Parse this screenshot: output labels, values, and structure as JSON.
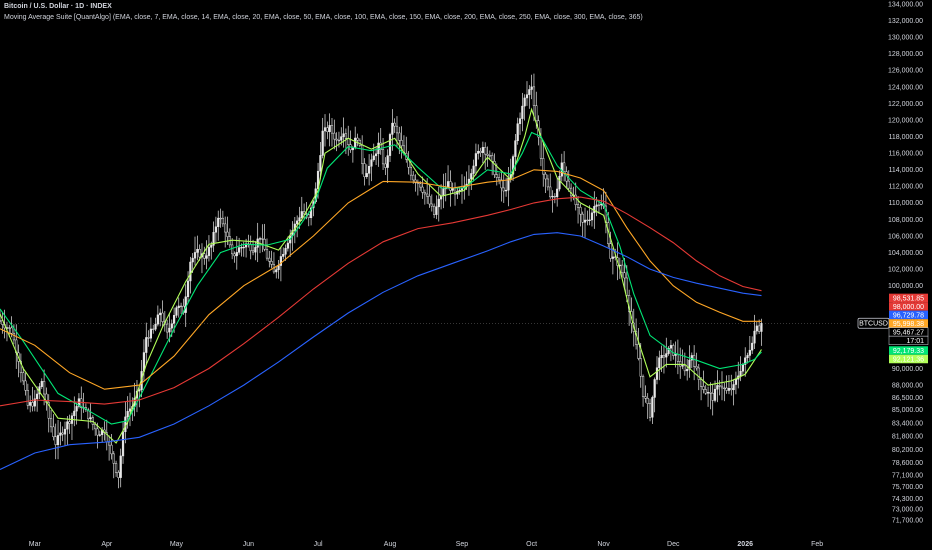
{
  "header": {
    "title": "Bitcoin / U.S. Dollar · 1D · INDEX",
    "indicator": "Moving Average Suite [QuantAlgo] (EMA, close, 7, EMA, close, 14, EMA, close, 20, EMA, close, 50, EMA, close, 100, EMA, close, 150, EMA, close, 200, EMA, close, 250, EMA, close, 300, EMA, close, 365)"
  },
  "colors": {
    "background": "#000000",
    "candle": "#e8e8e8",
    "axis_text": "#d1d4dc",
    "price_line": "#6b6b6b",
    "ema_light_green": "#b2ff59",
    "ema_green": "#00e676",
    "ema_orange": "#ffa726",
    "ema_red": "#e53935",
    "ema_blue": "#2962ff"
  },
  "chart_data": {
    "type": "candlestick",
    "symbol": "BTCUSD",
    "ylim": [
      70500,
      134500
    ],
    "y_ticks": [
      "134,000.00",
      "132,000.00",
      "130,000.00",
      "128,000.00",
      "126,000.00",
      "124,000.00",
      "122,000.00",
      "120,000.00",
      "118,000.00",
      "116,000.00",
      "114,000.00",
      "112,000.00",
      "110,000.00",
      "108,000.00",
      "106,000.00",
      "104,000.00",
      "102,000.00",
      "100,000.00",
      "98,000.00",
      "96,000.00",
      "94,000.00",
      "92,000.00",
      "90,000.00",
      "88,000.00",
      "86,500.00",
      "85,000.00",
      "83,400.00",
      "81,800.00",
      "80,200.00",
      "78,600.00",
      "77,100.00",
      "75,700.00",
      "74,300.00",
      "73,000.00",
      "71,700.00"
    ],
    "x_labels": [
      "Mar",
      "Apr",
      "May",
      "Jun",
      "Jul",
      "Aug",
      "Sep",
      "Oct",
      "Nov",
      "Dec",
      "2026",
      "Feb"
    ],
    "x_label_days": [
      0,
      31,
      61,
      92,
      122,
      153,
      184,
      214,
      245,
      275,
      306,
      337
    ],
    "x_range_days": [
      -15,
      352
    ],
    "close_anchors": [
      [
        -15,
        95800
      ],
      [
        -10,
        94500
      ],
      [
        -7,
        91200
      ],
      [
        -3,
        85500
      ],
      [
        0,
        86000
      ],
      [
        3,
        88500
      ],
      [
        6,
        84000
      ],
      [
        9,
        81000
      ],
      [
        12,
        82500
      ],
      [
        15,
        83800
      ],
      [
        19,
        86000
      ],
      [
        23,
        84300
      ],
      [
        27,
        82200
      ],
      [
        30,
        82600
      ],
      [
        33,
        79500
      ],
      [
        36,
        77000
      ],
      [
        39,
        84500
      ],
      [
        42,
        85500
      ],
      [
        45,
        87500
      ],
      [
        48,
        93800
      ],
      [
        51,
        94600
      ],
      [
        54,
        96800
      ],
      [
        57,
        94100
      ],
      [
        61,
        97500
      ],
      [
        64,
        97000
      ],
      [
        67,
        103000
      ],
      [
        70,
        104000
      ],
      [
        73,
        103500
      ],
      [
        76,
        104800
      ],
      [
        79,
        108500
      ],
      [
        82,
        106800
      ],
      [
        85,
        103500
      ],
      [
        88,
        104500
      ],
      [
        91,
        105000
      ],
      [
        94,
        104500
      ],
      [
        97,
        106000
      ],
      [
        100,
        103500
      ],
      [
        103,
        101500
      ],
      [
        106,
        103500
      ],
      [
        109,
        105500
      ],
      [
        112,
        107300
      ],
      [
        115,
        109000
      ],
      [
        118,
        108000
      ],
      [
        121,
        111500
      ],
      [
        124,
        118500
      ],
      [
        127,
        119000
      ],
      [
        130,
        117500
      ],
      [
        133,
        118800
      ],
      [
        136,
        116500
      ],
      [
        139,
        118000
      ],
      [
        142,
        113500
      ],
      [
        145,
        114800
      ],
      [
        148,
        117000
      ],
      [
        151,
        114000
      ],
      [
        154,
        119800
      ],
      [
        157,
        117500
      ],
      [
        160,
        115000
      ],
      [
        163,
        113000
      ],
      [
        166,
        112200
      ],
      [
        169,
        110500
      ],
      [
        172,
        108600
      ],
      [
        175,
        111000
      ],
      [
        178,
        112400
      ],
      [
        181,
        110800
      ],
      [
        184,
        111500
      ],
      [
        187,
        113200
      ],
      [
        190,
        115600
      ],
      [
        193,
        116800
      ],
      [
        196,
        115400
      ],
      [
        199,
        113000
      ],
      [
        202,
        111200
      ],
      [
        205,
        113300
      ],
      [
        208,
        119500
      ],
      [
        211,
        122500
      ],
      [
        214,
        124200
      ],
      [
        216,
        120000
      ],
      [
        219,
        113500
      ],
      [
        221,
        111500
      ],
      [
        224,
        110500
      ],
      [
        227,
        114600
      ],
      [
        230,
        112000
      ],
      [
        233,
        109800
      ],
      [
        236,
        107500
      ],
      [
        239,
        108300
      ],
      [
        242,
        110200
      ],
      [
        245,
        109500
      ],
      [
        248,
        103500
      ],
      [
        251,
        102800
      ],
      [
        254,
        101000
      ],
      [
        257,
        95500
      ],
      [
        260,
        91200
      ],
      [
        262,
        87000
      ],
      [
        265,
        84500
      ],
      [
        268,
        90500
      ],
      [
        271,
        91600
      ],
      [
        274,
        92400
      ],
      [
        277,
        91000
      ],
      [
        280,
        89500
      ],
      [
        283,
        91700
      ],
      [
        286,
        88700
      ],
      [
        289,
        87200
      ],
      [
        292,
        86500
      ],
      [
        295,
        88200
      ],
      [
        298,
        87200
      ],
      [
        301,
        87700
      ],
      [
        304,
        90000
      ],
      [
        307,
        91500
      ],
      [
        309,
        93500
      ],
      [
        311,
        95500
      ],
      [
        313,
        94000
      ]
    ],
    "series": [
      {
        "color": "#b2ff59",
        "points": [
          [
            -15,
            96600
          ],
          [
            -5,
            90000
          ],
          [
            10,
            84000
          ],
          [
            25,
            83600
          ],
          [
            35,
            81000
          ],
          [
            40,
            83500
          ],
          [
            48,
            90500
          ],
          [
            55,
            95000
          ],
          [
            65,
            100500
          ],
          [
            75,
            105000
          ],
          [
            85,
            105500
          ],
          [
            95,
            105300
          ],
          [
            105,
            104300
          ],
          [
            115,
            108000
          ],
          [
            122,
            111500
          ],
          [
            125,
            116000
          ],
          [
            135,
            117800
          ],
          [
            145,
            116500
          ],
          [
            155,
            117800
          ],
          [
            165,
            113500
          ],
          [
            175,
            110800
          ],
          [
            185,
            111500
          ],
          [
            195,
            115500
          ],
          [
            205,
            112800
          ],
          [
            211,
            118000
          ],
          [
            214,
            121300
          ],
          [
            218,
            118000
          ],
          [
            225,
            113000
          ],
          [
            235,
            110000
          ],
          [
            245,
            108500
          ],
          [
            252,
            102000
          ],
          [
            258,
            95000
          ],
          [
            265,
            89000
          ],
          [
            272,
            90500
          ],
          [
            280,
            90500
          ],
          [
            290,
            88000
          ],
          [
            300,
            88500
          ],
          [
            306,
            89300
          ],
          [
            310,
            91000
          ],
          [
            313,
            92300
          ]
        ]
      },
      {
        "color": "#00e676",
        "points": [
          [
            -15,
            97200
          ],
          [
            -5,
            93300
          ],
          [
            10,
            87000
          ],
          [
            25,
            84600
          ],
          [
            33,
            83300
          ],
          [
            40,
            83700
          ],
          [
            50,
            89200
          ],
          [
            60,
            94800
          ],
          [
            70,
            100000
          ],
          [
            80,
            104000
          ],
          [
            90,
            105000
          ],
          [
            100,
            104900
          ],
          [
            110,
            105600
          ],
          [
            120,
            109600
          ],
          [
            126,
            114200
          ],
          [
            135,
            116800
          ],
          [
            145,
            116300
          ],
          [
            155,
            117000
          ],
          [
            165,
            114300
          ],
          [
            175,
            111800
          ],
          [
            185,
            111800
          ],
          [
            195,
            114000
          ],
          [
            205,
            113500
          ],
          [
            210,
            116000
          ],
          [
            214,
            118500
          ],
          [
            218,
            118000
          ],
          [
            225,
            114500
          ],
          [
            235,
            111500
          ],
          [
            245,
            109800
          ],
          [
            252,
            104800
          ],
          [
            258,
            99000
          ],
          [
            265,
            94000
          ],
          [
            275,
            91900
          ],
          [
            285,
            91000
          ],
          [
            295,
            90000
          ],
          [
            305,
            90500
          ],
          [
            310,
            91100
          ],
          [
            313,
            92000
          ]
        ]
      },
      {
        "color": "#ffa726",
        "points": [
          [
            -15,
            94800
          ],
          [
            0,
            92800
          ],
          [
            15,
            89500
          ],
          [
            30,
            87500
          ],
          [
            45,
            88000
          ],
          [
            60,
            91500
          ],
          [
            75,
            96500
          ],
          [
            90,
            100000
          ],
          [
            105,
            102500
          ],
          [
            120,
            106000
          ],
          [
            135,
            110000
          ],
          [
            150,
            112600
          ],
          [
            165,
            112500
          ],
          [
            180,
            111800
          ],
          [
            195,
            112500
          ],
          [
            205,
            112800
          ],
          [
            215,
            114000
          ],
          [
            225,
            113800
          ],
          [
            235,
            113000
          ],
          [
            245,
            111500
          ],
          [
            255,
            107000
          ],
          [
            265,
            103000
          ],
          [
            275,
            100000
          ],
          [
            285,
            98000
          ],
          [
            295,
            96800
          ],
          [
            305,
            95700
          ],
          [
            313,
            95700
          ]
        ]
      },
      {
        "color": "#e53935",
        "points": [
          [
            -15,
            85500
          ],
          [
            0,
            86200
          ],
          [
            15,
            86000
          ],
          [
            30,
            85700
          ],
          [
            45,
            86200
          ],
          [
            60,
            87700
          ],
          [
            75,
            90000
          ],
          [
            90,
            93000
          ],
          [
            105,
            96200
          ],
          [
            120,
            99600
          ],
          [
            135,
            102700
          ],
          [
            150,
            105300
          ],
          [
            165,
            106900
          ],
          [
            180,
            107600
          ],
          [
            195,
            108500
          ],
          [
            205,
            109200
          ],
          [
            215,
            110000
          ],
          [
            225,
            110500
          ],
          [
            235,
            110700
          ],
          [
            245,
            110200
          ],
          [
            255,
            108700
          ],
          [
            265,
            107000
          ],
          [
            275,
            105200
          ],
          [
            285,
            103000
          ],
          [
            295,
            101200
          ],
          [
            305,
            99900
          ],
          [
            313,
            99400
          ]
        ]
      },
      {
        "color": "#2962ff",
        "points": [
          [
            -15,
            77800
          ],
          [
            0,
            79800
          ],
          [
            15,
            80800
          ],
          [
            30,
            81100
          ],
          [
            45,
            81700
          ],
          [
            60,
            83300
          ],
          [
            75,
            85500
          ],
          [
            90,
            88000
          ],
          [
            105,
            90800
          ],
          [
            120,
            93800
          ],
          [
            135,
            96700
          ],
          [
            150,
            99200
          ],
          [
            165,
            101200
          ],
          [
            180,
            102700
          ],
          [
            195,
            104200
          ],
          [
            205,
            105300
          ],
          [
            215,
            106200
          ],
          [
            225,
            106400
          ],
          [
            235,
            106000
          ],
          [
            245,
            104800
          ],
          [
            255,
            103500
          ],
          [
            265,
            102000
          ],
          [
            275,
            101000
          ],
          [
            285,
            100300
          ],
          [
            295,
            99700
          ],
          [
            305,
            99100
          ],
          [
            313,
            98800
          ]
        ]
      }
    ],
    "last_values": [
      {
        "value": "98,531.85",
        "color": "#e53935"
      },
      {
        "value": "98,000.00",
        "color": "#e53935"
      },
      {
        "value": "96,729.78",
        "color": "#2962ff"
      },
      {
        "value": "95,998.38",
        "color": "#ffa726"
      },
      {
        "value": "95,467.27",
        "color": "#ffffff"
      },
      {
        "value": "17:01",
        "color": "#ffffff"
      },
      {
        "value": "92,179.33",
        "color": "#00e676"
      },
      {
        "value": "92,121.36",
        "color": "#b2ff59"
      }
    ],
    "current_price": 95467.27
  }
}
